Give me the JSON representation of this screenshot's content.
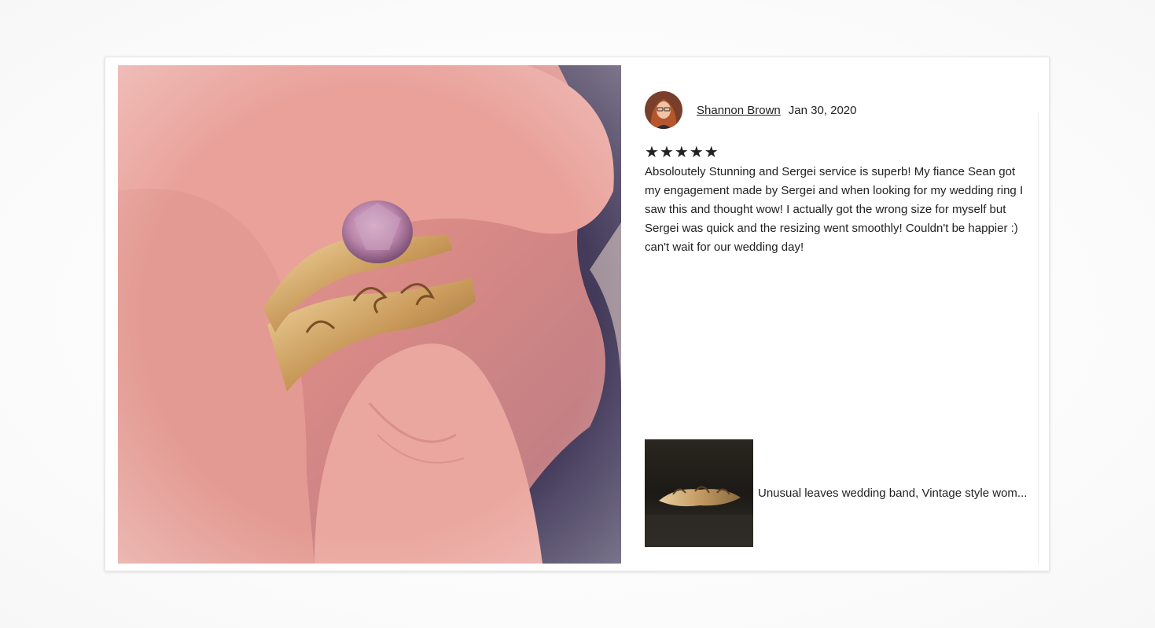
{
  "review": {
    "reviewer_name": "Shannon Brown",
    "date": "Jan 30, 2020",
    "rating": 5,
    "star_glyph": "★",
    "text": "Absoloutely Stunning and Sergei service is superb! My fiance Sean got my engagement made by Sergei and when looking for my wedding ring I saw this and thought wow! I actually got the wrong size for myself but Sergei was quick and the resizing went smoothly! Couldn't be happier :) can't wait for our wedding day!"
  },
  "product": {
    "title": "Unusual leaves wedding band, Vintage style wom..."
  },
  "icons": {
    "star": "star-icon"
  },
  "colors": {
    "text": "#222222",
    "border": "#e6e6e6"
  }
}
